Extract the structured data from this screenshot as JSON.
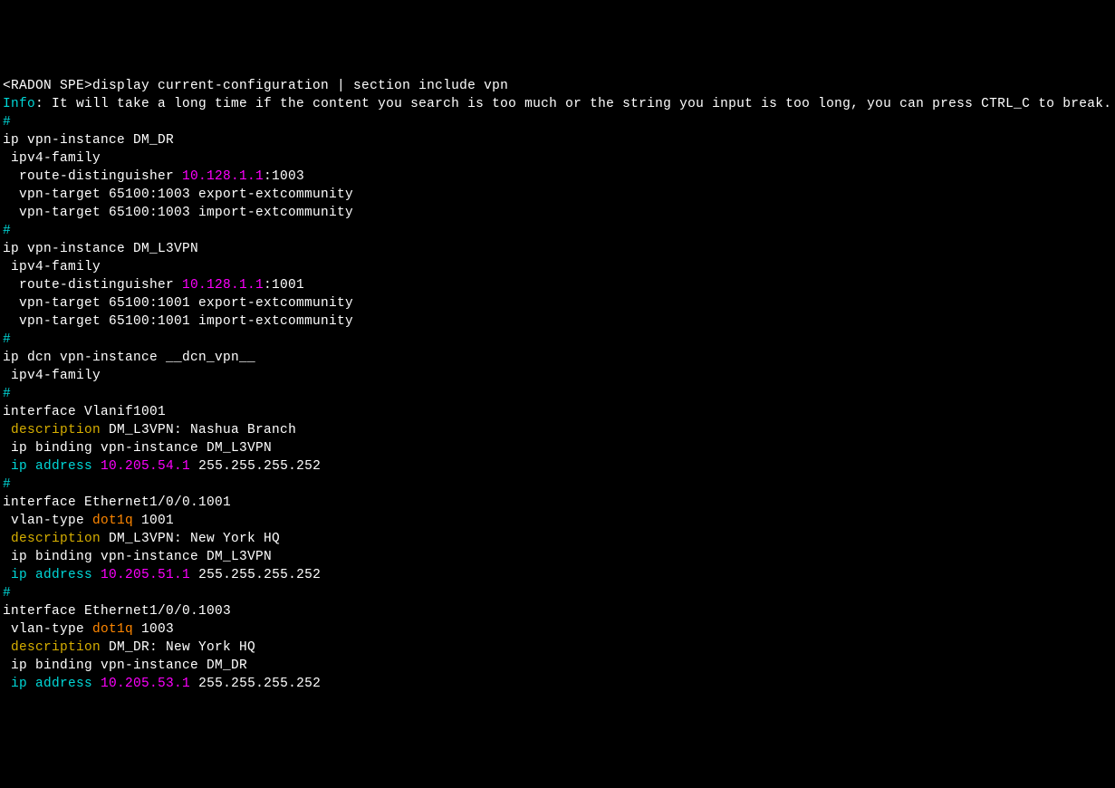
{
  "terminal": {
    "prompt_line": {
      "prompt": "<RADON SPE>",
      "command": "display current-configuration | section include vpn"
    },
    "info_line": {
      "info_label": "Info",
      "info_msg": ": It will take a long time if the content you search is too much or the string you input is too long, you can press CTRL_C to break."
    },
    "hash": "#",
    "block_dmdr": {
      "l1": "ip vpn-instance DM_DR",
      "l2": " ipv4-family",
      "l3a": "  route-distinguisher ",
      "l3_ip": "10.128.1.1",
      "l3b": ":1003",
      "l4": "  vpn-target 65100:1003 export-extcommunity",
      "l5": "  vpn-target 65100:1003 import-extcommunity"
    },
    "block_dml3vpn": {
      "l1": "ip vpn-instance DM_L3VPN",
      "l2": " ipv4-family",
      "l3a": "  route-distinguisher ",
      "l3_ip": "10.128.1.1",
      "l3b": ":1001",
      "l4": "  vpn-target 65100:1001 export-extcommunity",
      "l5": "  vpn-target 65100:1001 import-extcommunity"
    },
    "block_dcn": {
      "l1": "ip dcn vpn-instance __dcn_vpn__",
      "l2": " ipv4-family"
    },
    "block_vlanif1001": {
      "l1": "interface Vlanif1001",
      "l2a": " ",
      "l2_kw": "description",
      "l2b": " DM_L3VPN: Nashua Branch",
      "l3": " ip binding vpn-instance DM_L3VPN",
      "l4a": " ",
      "l4_kw": "ip address",
      "l4_sp": " ",
      "l4_ip": "10.205.54.1",
      "l4b": " 255.255.255.252"
    },
    "block_eth1001": {
      "l1": "interface Ethernet1/0/0.1001",
      "l2a": " vlan-type ",
      "l2_kw": "dot1q",
      "l2b": " 1001",
      "l3a": " ",
      "l3_kw": "description",
      "l3b": " DM_L3VPN: New York HQ",
      "l4": " ip binding vpn-instance DM_L3VPN",
      "l5a": " ",
      "l5_kw": "ip address",
      "l5_sp": " ",
      "l5_ip": "10.205.51.1",
      "l5b": " 255.255.255.252"
    },
    "block_eth1003": {
      "l1": "interface Ethernet1/0/0.1003",
      "l2a": " vlan-type ",
      "l2_kw": "dot1q",
      "l2b": " 1003",
      "l3a": " ",
      "l3_kw": "description",
      "l3b": " DM_DR: New York HQ",
      "l4": " ip binding vpn-instance DM_DR",
      "l5a": " ",
      "l5_kw": "ip address",
      "l5_sp": " ",
      "l5_ip": "10.205.53.1",
      "l5b": " 255.255.255.252"
    }
  }
}
